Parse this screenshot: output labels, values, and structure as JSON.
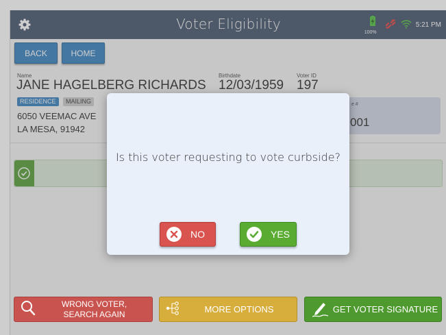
{
  "app": {
    "title": "Voter Eligibility"
  },
  "status": {
    "battery": "100%",
    "time": "5:21 PM"
  },
  "nav": {
    "back": "BACK",
    "home": "HOME"
  },
  "voter": {
    "name_label": "Name",
    "name": "JANE HAGELBERG RICHARDS",
    "birthdate_label": "Birthdate",
    "birthdate": "12/03/1959",
    "voter_id_label": "Voter ID",
    "voter_id": "197",
    "tabs": [
      "RESIDENCE",
      "MAILING"
    ],
    "address_line1": "6050 VEEMAC AVE",
    "address_line2": "LA MESA, 91942",
    "card_label": "e #",
    "card_value": "001"
  },
  "dialog": {
    "question": "Is this voter requesting to vote curbside?",
    "no_label": "NO",
    "yes_label": "YES"
  },
  "actions": {
    "wrong_voter": "WRONG VOTER, SEARCH AGAIN",
    "wrong_voter_line1": "WRONG VOTER,",
    "wrong_voter_line2": "SEARCH AGAIN",
    "more_options": "MORE OPTIONS",
    "get_signature": "GET VOTER SIGNATURE"
  },
  "colors": {
    "titlebar": "#3c4c64",
    "primary": "#2e7cbd",
    "danger": "#d9534f",
    "warning": "#e0b23a",
    "success": "#4e9a2e"
  },
  "icons": [
    "gear-icon",
    "battery-icon",
    "unlinked-icon",
    "wifi-icon",
    "check-icon",
    "close-icon",
    "search-icon",
    "options-icon",
    "pen-icon"
  ]
}
